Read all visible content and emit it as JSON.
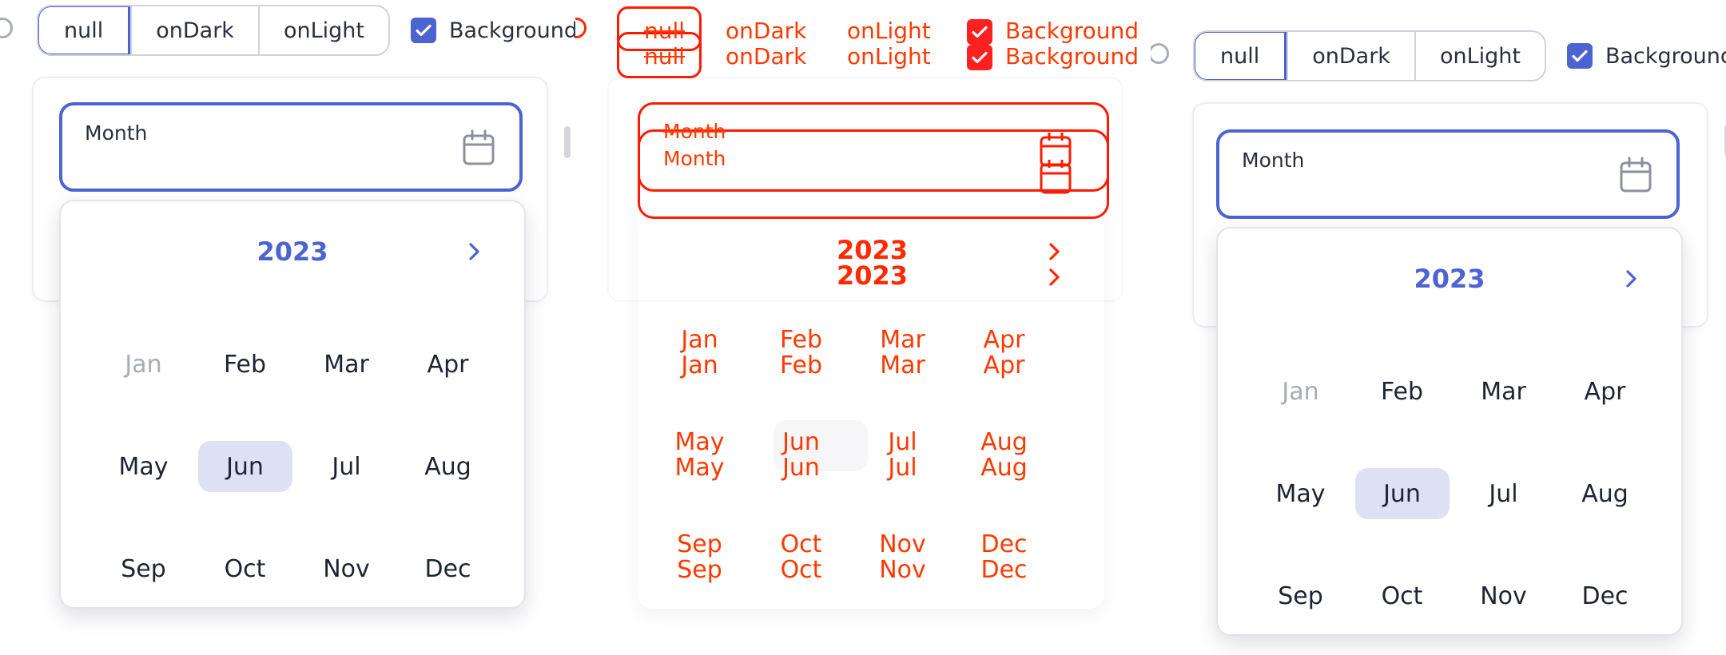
{
  "toolbar": {
    "segments": [
      "null",
      "onDark",
      "onLight"
    ],
    "active_segment": "null",
    "background_label": "Background",
    "background_checked": true
  },
  "field": {
    "label": "Month"
  },
  "picker": {
    "year": "2023",
    "months": [
      "Jan",
      "Feb",
      "Mar",
      "Apr",
      "May",
      "Jun",
      "Jul",
      "Aug",
      "Sep",
      "Oct",
      "Nov",
      "Dec"
    ],
    "disabled_month": "Jan",
    "selected_month": "Jun"
  },
  "icons": [
    "help-icon",
    "checkmark-icon",
    "calendar-icon",
    "chevron-right-icon"
  ],
  "colors": {
    "accent": "#4c63d2",
    "selected_bg": "#dde1f3",
    "outline_red": "#ff1a00",
    "outline_orange": "#ff3a00"
  }
}
